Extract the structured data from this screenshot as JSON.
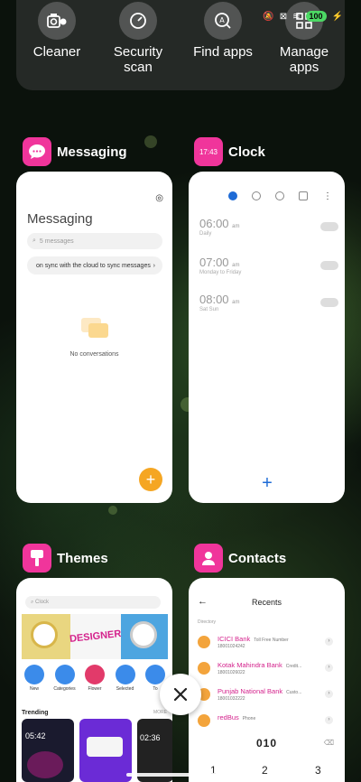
{
  "quick_panel": {
    "items": [
      {
        "label": "Cleaner",
        "icon": "cleaner-icon"
      },
      {
        "label": "Security\nscan",
        "icon": "security-scan-icon"
      },
      {
        "label": "Find apps",
        "icon": "find-apps-icon"
      },
      {
        "label": "Manage\napps",
        "icon": "manage-apps-icon"
      }
    ]
  },
  "status_bar": {
    "battery": "100"
  },
  "apps": {
    "messaging": {
      "name": "Messaging",
      "title": "Messaging",
      "search_placeholder": "5 messages",
      "sync_banner": "on sync with the cloud to sync messages",
      "empty_text": "No conversations",
      "fab": "+",
      "accent": "#f59e0b"
    },
    "clock": {
      "name": "Clock",
      "icon_text": "17:43",
      "alarms": [
        {
          "time": "06:00",
          "suffix": "am",
          "repeat": "Daily"
        },
        {
          "time": "07:00",
          "suffix": "am",
          "repeat": "Monday to Friday"
        },
        {
          "time": "08:00",
          "suffix": "am",
          "repeat": "Sat Sun"
        }
      ],
      "fab": "+"
    },
    "themes": {
      "name": "Themes",
      "search_placeholder": "Clock",
      "banner_text": "DESIGNER",
      "categories": [
        "New",
        "Categories",
        "Flower",
        "Selected",
        "To"
      ],
      "trending_label": "Trending",
      "more_label": "MORE",
      "thumb_times": [
        "05:42",
        "02:36"
      ]
    },
    "contacts": {
      "name": "Contacts",
      "title": "Recents",
      "directory_label": "Directory",
      "entries": [
        {
          "name": "ICICI Bank",
          "type": "Toll Free Number",
          "number": "18001024242"
        },
        {
          "name": "Kotak Mahindra Bank",
          "type": "Credit...",
          "number": "18001026022"
        },
        {
          "name": "Punjab National Bank",
          "type": "Custo...",
          "number": "18001032222"
        },
        {
          "name": "redBus",
          "type": "Phone",
          "number": ""
        }
      ],
      "dial_input": "010",
      "dial_keys": [
        "1",
        "2",
        "3"
      ]
    }
  }
}
